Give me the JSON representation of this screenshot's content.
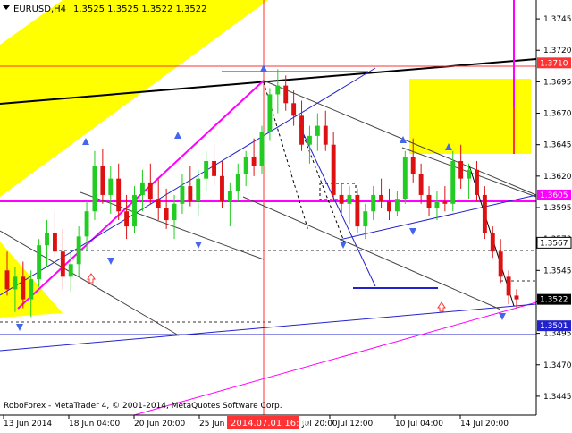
{
  "header": {
    "symbol_timeframe": "EURUSD,H4",
    "ohlc": "1.3525 1.3525 1.3522 1.3522"
  },
  "footer": {
    "copyright": "RoboForex - MetaTrader 4, © 2001-2014, MetaQuotes Software Corp."
  },
  "colors": {
    "background": "#ffffff",
    "bull_candle": "#22cc22",
    "bear_candle": "#dd1111",
    "magenta": "#ff00ff",
    "red_line": "#ff3333",
    "blue_line": "#2222cc",
    "yellow_zone": "#ffff00",
    "black_line": "#000000",
    "gray_line": "#444444"
  },
  "price_axis": {
    "ticks": [
      "1.3745",
      "1.3720",
      "1.3695",
      "1.3670",
      "1.3645",
      "1.3620",
      "1.3595",
      "1.3570",
      "1.3545",
      "1.3520",
      "1.3495",
      "1.3470",
      "1.3445"
    ],
    "highlighted": [
      {
        "label": "1.3710",
        "value": 1.371,
        "style": "red"
      },
      {
        "label": "1.3605",
        "value": 1.3605,
        "style": "magenta"
      },
      {
        "label": "1.3567",
        "value": 1.3567,
        "style": "dark"
      },
      {
        "label": "1.3522",
        "value": 1.3522,
        "style": "black"
      },
      {
        "label": "1.3501",
        "value": 1.3501,
        "style": "blue"
      }
    ]
  },
  "time_axis": {
    "ticks": [
      "13 Jun 2014",
      "18 Jun 04:00",
      "20 Jun 20:00",
      "25 Jun 12:00",
      "Jul 20:00",
      "7 Jul 12:00",
      "10 Jul 04:00",
      "14 Jul 20:00"
    ],
    "highlighted_label": "2014.07.01 16:00"
  },
  "chart_data": {
    "type": "candlestick",
    "title": "EURUSD,H4",
    "ylim": [
      1.343,
      1.376
    ],
    "series": [
      {
        "o": 1.3545,
        "h": 1.356,
        "l": 1.3525,
        "c": 1.353
      },
      {
        "o": 1.353,
        "h": 1.3548,
        "l": 1.3512,
        "c": 1.354
      },
      {
        "o": 1.354,
        "h": 1.3552,
        "l": 1.3515,
        "c": 1.3522
      },
      {
        "o": 1.3522,
        "h": 1.3545,
        "l": 1.3508,
        "c": 1.3538
      },
      {
        "o": 1.3538,
        "h": 1.357,
        "l": 1.3532,
        "c": 1.3565
      },
      {
        "o": 1.3565,
        "h": 1.3585,
        "l": 1.3548,
        "c": 1.3575
      },
      {
        "o": 1.3575,
        "h": 1.3592,
        "l": 1.3555,
        "c": 1.356
      },
      {
        "o": 1.356,
        "h": 1.3578,
        "l": 1.353,
        "c": 1.354
      },
      {
        "o": 1.354,
        "h": 1.356,
        "l": 1.3528,
        "c": 1.355
      },
      {
        "o": 1.355,
        "h": 1.358,
        "l": 1.354,
        "c": 1.3572
      },
      {
        "o": 1.3572,
        "h": 1.36,
        "l": 1.356,
        "c": 1.3592
      },
      {
        "o": 1.3592,
        "h": 1.364,
        "l": 1.3585,
        "c": 1.3628
      },
      {
        "o": 1.3628,
        "h": 1.3642,
        "l": 1.3598,
        "c": 1.3605
      },
      {
        "o": 1.3605,
        "h": 1.3628,
        "l": 1.359,
        "c": 1.3618
      },
      {
        "o": 1.3618,
        "h": 1.363,
        "l": 1.3585,
        "c": 1.3592
      },
      {
        "o": 1.3592,
        "h": 1.3605,
        "l": 1.357,
        "c": 1.358
      },
      {
        "o": 1.358,
        "h": 1.3612,
        "l": 1.3575,
        "c": 1.3605
      },
      {
        "o": 1.3605,
        "h": 1.3625,
        "l": 1.3592,
        "c": 1.3615
      },
      {
        "o": 1.3615,
        "h": 1.363,
        "l": 1.3598,
        "c": 1.3602
      },
      {
        "o": 1.3602,
        "h": 1.3618,
        "l": 1.3585,
        "c": 1.3595
      },
      {
        "o": 1.3595,
        "h": 1.361,
        "l": 1.3578,
        "c": 1.3585
      },
      {
        "o": 1.3585,
        "h": 1.3605,
        "l": 1.357,
        "c": 1.3598
      },
      {
        "o": 1.3598,
        "h": 1.3622,
        "l": 1.359,
        "c": 1.3612
      },
      {
        "o": 1.3612,
        "h": 1.3628,
        "l": 1.3596,
        "c": 1.36
      },
      {
        "o": 1.36,
        "h": 1.3625,
        "l": 1.3588,
        "c": 1.3618
      },
      {
        "o": 1.3618,
        "h": 1.364,
        "l": 1.3608,
        "c": 1.3632
      },
      {
        "o": 1.3632,
        "h": 1.3645,
        "l": 1.3612,
        "c": 1.362
      },
      {
        "o": 1.362,
        "h": 1.3632,
        "l": 1.3595,
        "c": 1.36
      },
      {
        "o": 1.36,
        "h": 1.3615,
        "l": 1.358,
        "c": 1.3608
      },
      {
        "o": 1.3608,
        "h": 1.363,
        "l": 1.36,
        "c": 1.3622
      },
      {
        "o": 1.3622,
        "h": 1.364,
        "l": 1.3612,
        "c": 1.3635
      },
      {
        "o": 1.3635,
        "h": 1.365,
        "l": 1.362,
        "c": 1.3628
      },
      {
        "o": 1.3628,
        "h": 1.366,
        "l": 1.3622,
        "c": 1.3655
      },
      {
        "o": 1.3655,
        "h": 1.369,
        "l": 1.3648,
        "c": 1.3685
      },
      {
        "o": 1.3685,
        "h": 1.3705,
        "l": 1.367,
        "c": 1.3692
      },
      {
        "o": 1.3692,
        "h": 1.37,
        "l": 1.3672,
        "c": 1.3678
      },
      {
        "o": 1.3678,
        "h": 1.3688,
        "l": 1.366,
        "c": 1.3668
      },
      {
        "o": 1.3668,
        "h": 1.368,
        "l": 1.364,
        "c": 1.3645
      },
      {
        "o": 1.3645,
        "h": 1.366,
        "l": 1.363,
        "c": 1.3652
      },
      {
        "o": 1.3652,
        "h": 1.367,
        "l": 1.364,
        "c": 1.366
      },
      {
        "o": 1.366,
        "h": 1.3672,
        "l": 1.364,
        "c": 1.3645
      },
      {
        "o": 1.3645,
        "h": 1.3655,
        "l": 1.36,
        "c": 1.3605
      },
      {
        "o": 1.3605,
        "h": 1.3615,
        "l": 1.3588,
        "c": 1.3598
      },
      {
        "o": 1.3598,
        "h": 1.3612,
        "l": 1.3582,
        "c": 1.3605
      },
      {
        "o": 1.3605,
        "h": 1.361,
        "l": 1.3575,
        "c": 1.358
      },
      {
        "o": 1.358,
        "h": 1.3598,
        "l": 1.357,
        "c": 1.3592
      },
      {
        "o": 1.3592,
        "h": 1.3612,
        "l": 1.3585,
        "c": 1.3605
      },
      {
        "o": 1.3605,
        "h": 1.3618,
        "l": 1.3595,
        "c": 1.36
      },
      {
        "o": 1.36,
        "h": 1.361,
        "l": 1.3585,
        "c": 1.3592
      },
      {
        "o": 1.3592,
        "h": 1.3608,
        "l": 1.3588,
        "c": 1.3602
      },
      {
        "o": 1.3602,
        "h": 1.364,
        "l": 1.3598,
        "c": 1.3635
      },
      {
        "o": 1.3635,
        "h": 1.365,
        "l": 1.3615,
        "c": 1.3622
      },
      {
        "o": 1.3622,
        "h": 1.363,
        "l": 1.3598,
        "c": 1.3605
      },
      {
        "o": 1.3605,
        "h": 1.3612,
        "l": 1.3588,
        "c": 1.3595
      },
      {
        "o": 1.3595,
        "h": 1.3608,
        "l": 1.3585,
        "c": 1.36
      },
      {
        "o": 1.36,
        "h": 1.3612,
        "l": 1.3592,
        "c": 1.3598
      },
      {
        "o": 1.3598,
        "h": 1.364,
        "l": 1.3592,
        "c": 1.3632
      },
      {
        "o": 1.3632,
        "h": 1.3645,
        "l": 1.361,
        "c": 1.3618
      },
      {
        "o": 1.3618,
        "h": 1.363,
        "l": 1.3602,
        "c": 1.3625
      },
      {
        "o": 1.3625,
        "h": 1.3632,
        "l": 1.36,
        "c": 1.3605
      },
      {
        "o": 1.3605,
        "h": 1.3612,
        "l": 1.357,
        "c": 1.3575
      },
      {
        "o": 1.3575,
        "h": 1.358,
        "l": 1.3555,
        "c": 1.356
      },
      {
        "o": 1.356,
        "h": 1.357,
        "l": 1.3535,
        "c": 1.354
      },
      {
        "o": 1.354,
        "h": 1.3545,
        "l": 1.3518,
        "c": 1.3525
      },
      {
        "o": 1.3525,
        "h": 1.353,
        "l": 1.3515,
        "c": 1.3522
      }
    ]
  }
}
